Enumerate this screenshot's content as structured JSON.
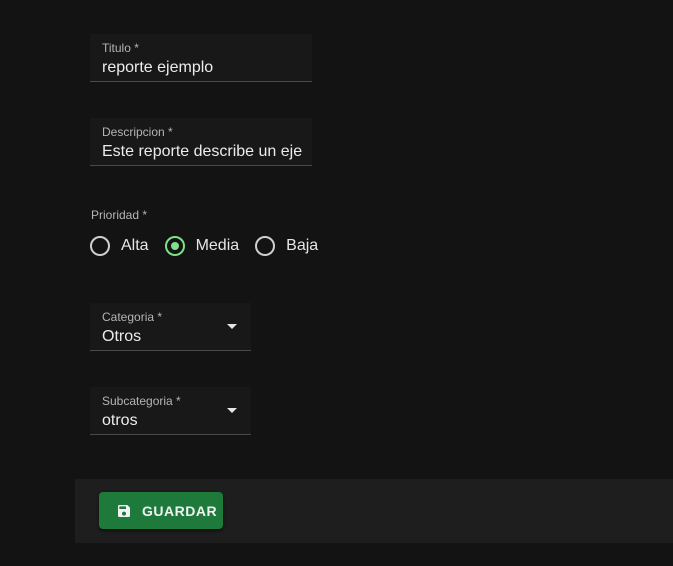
{
  "form": {
    "titulo": {
      "label": "Titulo *",
      "value": "reporte ejemplo"
    },
    "descripcion": {
      "label": "Descripcion *",
      "value": "Este reporte describe un ejemplo"
    },
    "prioridad": {
      "label": "Prioridad *",
      "options": [
        "Alta",
        "Media",
        "Baja"
      ],
      "selected": "Media"
    },
    "categoria": {
      "label": "Categoria *",
      "value": "Otros"
    },
    "subcategoria": {
      "label": "Subcategoria *",
      "value": "otros"
    }
  },
  "footer": {
    "save_label": "GUARDAR",
    "save_icon": "save-icon"
  },
  "colors": {
    "accent": "#7ee08a",
    "button": "#1e7a3b"
  }
}
